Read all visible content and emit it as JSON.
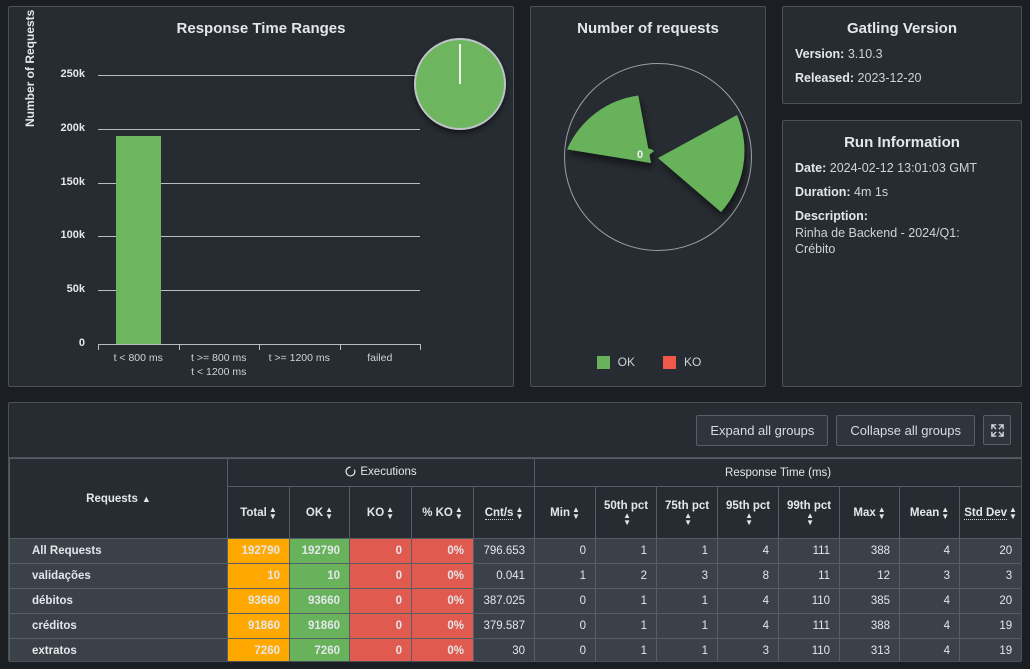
{
  "colors": {
    "ok_green": "#68b25b",
    "ko_red": "#f0584c",
    "total_orange": "#ffa900",
    "panel_bg": "#272c32",
    "page_bg": "#1b1e23"
  },
  "bar_panel": {
    "title": "Response Time Ranges",
    "ylabel": "Number of Requests"
  },
  "pie_panel": {
    "title": "Number of requests",
    "center_label": "0",
    "legend": [
      {
        "label": "OK",
        "color": "#68b25b"
      },
      {
        "label": "KO",
        "color": "#f0584c"
      }
    ]
  },
  "version_panel": {
    "title": "Gatling Version",
    "version_label": "Version:",
    "version_value": "3.10.3",
    "released_label": "Released:",
    "released_value": "2023-12-20"
  },
  "run_panel": {
    "title": "Run Information",
    "date_label": "Date:",
    "date_value": "2024-02-12 13:01:03 GMT",
    "duration_label": "Duration:",
    "duration_value": "4m 1s",
    "description_label": "Description:",
    "description_value": "Rinha de Backend - 2024/Q1: Crébito"
  },
  "toolbar": {
    "expand_label": "Expand all groups",
    "collapse_label": "Collapse all groups",
    "fullscreen_icon": "fullscreen-icon"
  },
  "table": {
    "requests_header": "Requests",
    "requests_sort": "▲",
    "group_executions": "Executions",
    "group_response_time": "Response Time (ms)",
    "columns": [
      {
        "key": "total",
        "label": "Total",
        "dotted": false
      },
      {
        "key": "ok",
        "label": "OK",
        "dotted": false
      },
      {
        "key": "ko",
        "label": "KO",
        "dotted": false
      },
      {
        "key": "pko",
        "label": "% KO",
        "dotted": false
      },
      {
        "key": "cnts",
        "label": "Cnt/s",
        "dotted": true
      },
      {
        "key": "min",
        "label": "Min",
        "dotted": false
      },
      {
        "key": "p50",
        "label": "50th pct",
        "dotted": false
      },
      {
        "key": "p75",
        "label": "75th pct",
        "dotted": false
      },
      {
        "key": "p95",
        "label": "95th pct",
        "dotted": false
      },
      {
        "key": "p99",
        "label": "99th pct",
        "dotted": false
      },
      {
        "key": "max",
        "label": "Max",
        "dotted": false
      },
      {
        "key": "mean",
        "label": "Mean",
        "dotted": false
      },
      {
        "key": "stddev",
        "label": "Std Dev",
        "dotted": true
      }
    ],
    "rows": [
      {
        "name": "All Requests",
        "total": "192790",
        "ok": "192790",
        "ko": "0",
        "pko": "0%",
        "cnts": "796.653",
        "min": "0",
        "p50": "1",
        "p75": "1",
        "p95": "4",
        "p99": "111",
        "max": "388",
        "mean": "4",
        "stddev": "20"
      },
      {
        "name": "validações",
        "total": "10",
        "ok": "10",
        "ko": "0",
        "pko": "0%",
        "cnts": "0.041",
        "min": "1",
        "p50": "2",
        "p75": "3",
        "p95": "8",
        "p99": "11",
        "max": "12",
        "mean": "3",
        "stddev": "3"
      },
      {
        "name": "débitos",
        "total": "93660",
        "ok": "93660",
        "ko": "0",
        "pko": "0%",
        "cnts": "387.025",
        "min": "0",
        "p50": "1",
        "p75": "1",
        "p95": "4",
        "p99": "110",
        "max": "385",
        "mean": "4",
        "stddev": "20"
      },
      {
        "name": "créditos",
        "total": "91860",
        "ok": "91860",
        "ko": "0",
        "pko": "0%",
        "cnts": "379.587",
        "min": "0",
        "p50": "1",
        "p75": "1",
        "p95": "4",
        "p99": "111",
        "max": "388",
        "mean": "4",
        "stddev": "19"
      },
      {
        "name": "extratos",
        "total": "7260",
        "ok": "7260",
        "ko": "0",
        "pko": "0%",
        "cnts": "30",
        "min": "0",
        "p50": "1",
        "p75": "1",
        "p95": "3",
        "p99": "110",
        "max": "313",
        "mean": "4",
        "stddev": "19"
      }
    ]
  },
  "chart_data": [
    {
      "type": "bar",
      "title": "Response Time Ranges",
      "xlabel": "",
      "ylabel": "Number of Requests",
      "categories": [
        "t < 800 ms",
        "t >= 800 ms\nt < 1200 ms",
        "t >= 1200 ms",
        "failed"
      ],
      "values": [
        192790,
        0,
        0,
        0
      ],
      "yticks": [
        0,
        50000,
        100000,
        150000,
        200000,
        250000
      ],
      "ytick_labels": [
        "0",
        "50k",
        "100k",
        "150k",
        "200k",
        "250k"
      ],
      "ylim": [
        0,
        262000
      ],
      "grid": true,
      "colors": [
        "#6db55e",
        "#ffa900",
        "#e05a4f",
        "#e05a4f"
      ],
      "inset_pie": {
        "type": "pie",
        "labels": [
          "t < 800 ms",
          "t >= 800 ms t < 1200 ms",
          "t >= 1200 ms",
          "failed"
        ],
        "values": [
          100,
          0,
          0,
          0
        ],
        "colors": [
          "#6db55e",
          "#ffa900",
          "#e05a4f",
          "#e05a4f"
        ]
      }
    },
    {
      "type": "pie",
      "title": "Number of requests",
      "labels": [
        "débitos",
        "créditos",
        "extratos",
        "validações",
        "KO"
      ],
      "values": [
        93660,
        91860,
        7260,
        10,
        0
      ],
      "colors": [
        "#68b25b",
        "#68b25b",
        "#68b25b",
        "#68b25b",
        "#f0584c"
      ],
      "center_annotation": "0",
      "legend": [
        "OK",
        "KO"
      ],
      "legend_position": "bottom",
      "exploded": true
    }
  ]
}
